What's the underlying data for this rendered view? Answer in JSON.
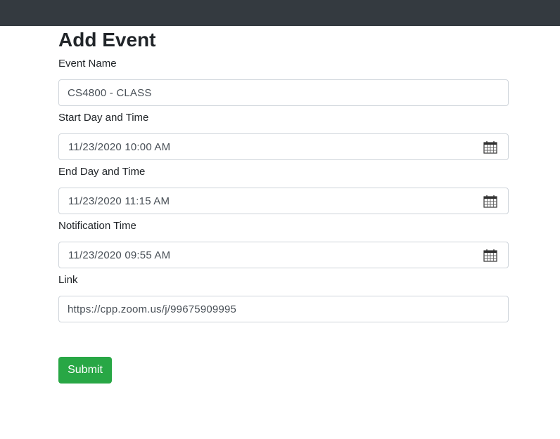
{
  "form": {
    "title": "Add Event",
    "fields": [
      {
        "label": "Event Name",
        "value": "CS4800 - CLASS",
        "icon": null
      },
      {
        "label": "Start Day and Time",
        "value": "11/23/2020 10:00 AM",
        "icon": "calendar-icon"
      },
      {
        "label": "End Day and Time",
        "value": "11/23/2020 11:15 AM",
        "icon": "calendar-icon"
      },
      {
        "label": "Notification Time",
        "value": "11/23/2020 09:55 AM",
        "icon": "calendar-icon"
      },
      {
        "label": "Link",
        "value": "https://cpp.zoom.us/j/99675909995",
        "icon": null
      }
    ],
    "submit_label": "Submit"
  },
  "colors": {
    "navbar": "#343a40",
    "submit": "#28a745",
    "border": "#ced4da",
    "input_text": "#495057"
  }
}
